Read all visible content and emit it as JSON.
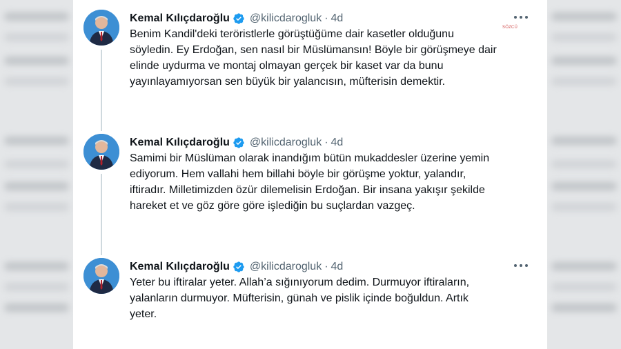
{
  "tweets": [
    {
      "author": "Kemal Kılıçdaroğlu",
      "handle": "@kilicdarogluk",
      "separator": "·",
      "time": "4d",
      "lines": [
        "Benim Kandil'deki teröristlerle görüştüğüme dair kasetler olduğunu",
        "söyledin. Ey Erdoğan, sen nasıl bir Müslümansın! Böyle bir görüşmeye dair",
        "elinde uydurma ve montaj olmayan gerçek bir kaset var da bunu",
        "yayınlayamıyorsan sen büyük bir yalancısın, müfterisin demektir."
      ]
    },
    {
      "author": "Kemal Kılıçdaroğlu",
      "handle": "@kilicdarogluk",
      "separator": "·",
      "time": "4d",
      "lines": [
        "Samimi bir Müslüman olarak inandığım bütün mukaddesler üzerine yemin",
        "ediyorum. Hem vallahi hem billahi böyle bir görüşme yoktur, yalandır,",
        "iftiradır. Milletimizden özür dilemelisin Erdoğan. Bir insana yakışır şekilde",
        "hareket et ve göz göre göre işlediğin bu suçlardan vazgeç."
      ]
    },
    {
      "author": "Kemal Kılıçdaroğlu",
      "handle": "@kilicdarogluk",
      "separator": "·",
      "time": "4d",
      "lines": [
        "Yeter bu iftiralar yeter. Allah’a sığınıyorum dedim. Durmuyor iftiraların,",
        "yalanların durmuyor. Müfterisin, günah ve pislik içinde boğuldun. Artık",
        "yeter."
      ]
    }
  ],
  "watermark": "SÖZCÜ",
  "colors": {
    "verified": "#1d9bf0",
    "text": "#0f1419",
    "secondary": "#536471",
    "thread_line": "#cfd9de"
  },
  "icons": {
    "verified": "verified-badge-icon",
    "more": "more-options-icon"
  }
}
